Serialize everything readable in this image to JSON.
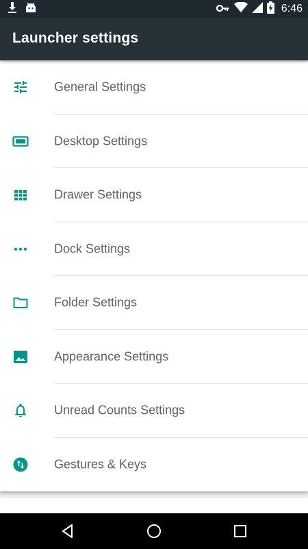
{
  "status_bar": {
    "time": "6:46",
    "left_icons": [
      "download-icon",
      "android-icon"
    ],
    "right_icons": [
      "vpn-key-icon",
      "wifi-icon",
      "signal-icon",
      "battery-charging-icon"
    ]
  },
  "app_bar": {
    "title": "Launcher settings"
  },
  "settings": {
    "items": [
      {
        "label": "General Settings",
        "icon": "tune-icon"
      },
      {
        "label": "Desktop Settings",
        "icon": "desktop-icon"
      },
      {
        "label": "Drawer Settings",
        "icon": "grid-icon"
      },
      {
        "label": "Dock Settings",
        "icon": "more-horizontal-icon"
      },
      {
        "label": "Folder Settings",
        "icon": "folder-icon"
      },
      {
        "label": "Appearance Settings",
        "icon": "image-icon"
      },
      {
        "label": "Unread Counts Settings",
        "icon": "bell-icon"
      },
      {
        "label": "Gestures & Keys",
        "icon": "swap-vertical-icon"
      }
    ]
  },
  "nav_bar": {
    "buttons": [
      "back-icon",
      "home-icon",
      "recents-icon"
    ]
  },
  "colors": {
    "accent": "#009688",
    "status_bar": "#1e2a2f",
    "app_bar": "#263238",
    "label_text": "#5f6368",
    "divider": "#e0e0e0",
    "background": "#eeeeee"
  }
}
